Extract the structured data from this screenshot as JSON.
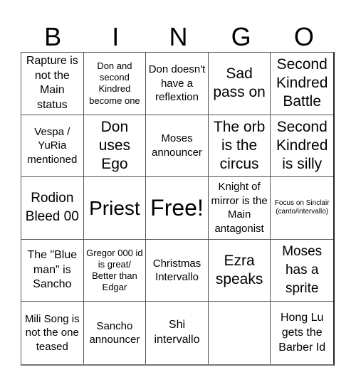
{
  "header": {
    "letters": [
      "B",
      "I",
      "N",
      "G",
      "O"
    ]
  },
  "board": {
    "cells": [
      "Rapture is not the Main status",
      "Don and second Kindred become one",
      "Don doesn't have a reflextion",
      "Sad pass on",
      "Second Kindred Battle",
      "Vespa / YuRia mentioned",
      "Don uses Ego",
      "Moses announcer",
      "The orb is the circus",
      "Second Kindred is silly",
      "Rodion Bleed 00",
      "Priest",
      "Free!",
      "Knight of mirror is the Main antagonist",
      "Focus on Sinclair (canto/intervallo)",
      "The \"Blue man\" is Sancho",
      "Gregor 000 id is great/ Better than Edgar",
      "Christmas Intervallo",
      "Ezra speaks",
      "Moses has a sprite",
      "Mili Song is not the one teased",
      "Sancho announcer",
      "Shi intervallo",
      "",
      "Hong Lu gets the Barber Id"
    ]
  }
}
